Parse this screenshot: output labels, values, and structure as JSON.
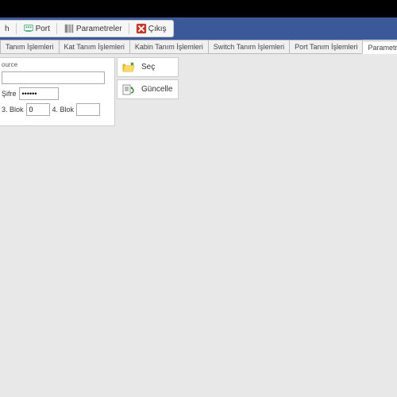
{
  "toolbar": {
    "item1_partial": "h",
    "port": "Port",
    "parametreler": "Parametreler",
    "cikis": "Çıkış"
  },
  "tabs": [
    {
      "label": "Tanım İşlemleri"
    },
    {
      "label": "Kat Tanım İşlemleri"
    },
    {
      "label": "Kabin Tanım İşlemleri"
    },
    {
      "label": "Switch Tanım İşlemleri"
    },
    {
      "label": "Port Tanım İşlemleri"
    },
    {
      "label": "Parametreler"
    }
  ],
  "panel": {
    "title": "ource",
    "topValue": "",
    "sifreLabel": "Şifre",
    "sifreValue": "••••••",
    "blok3Label": "3. Blok",
    "blok3Value": "0",
    "blok4Label": "4. Blok",
    "blok4Value": ""
  },
  "actions": {
    "sec": "Seç",
    "guncelle": "Güncelle"
  }
}
